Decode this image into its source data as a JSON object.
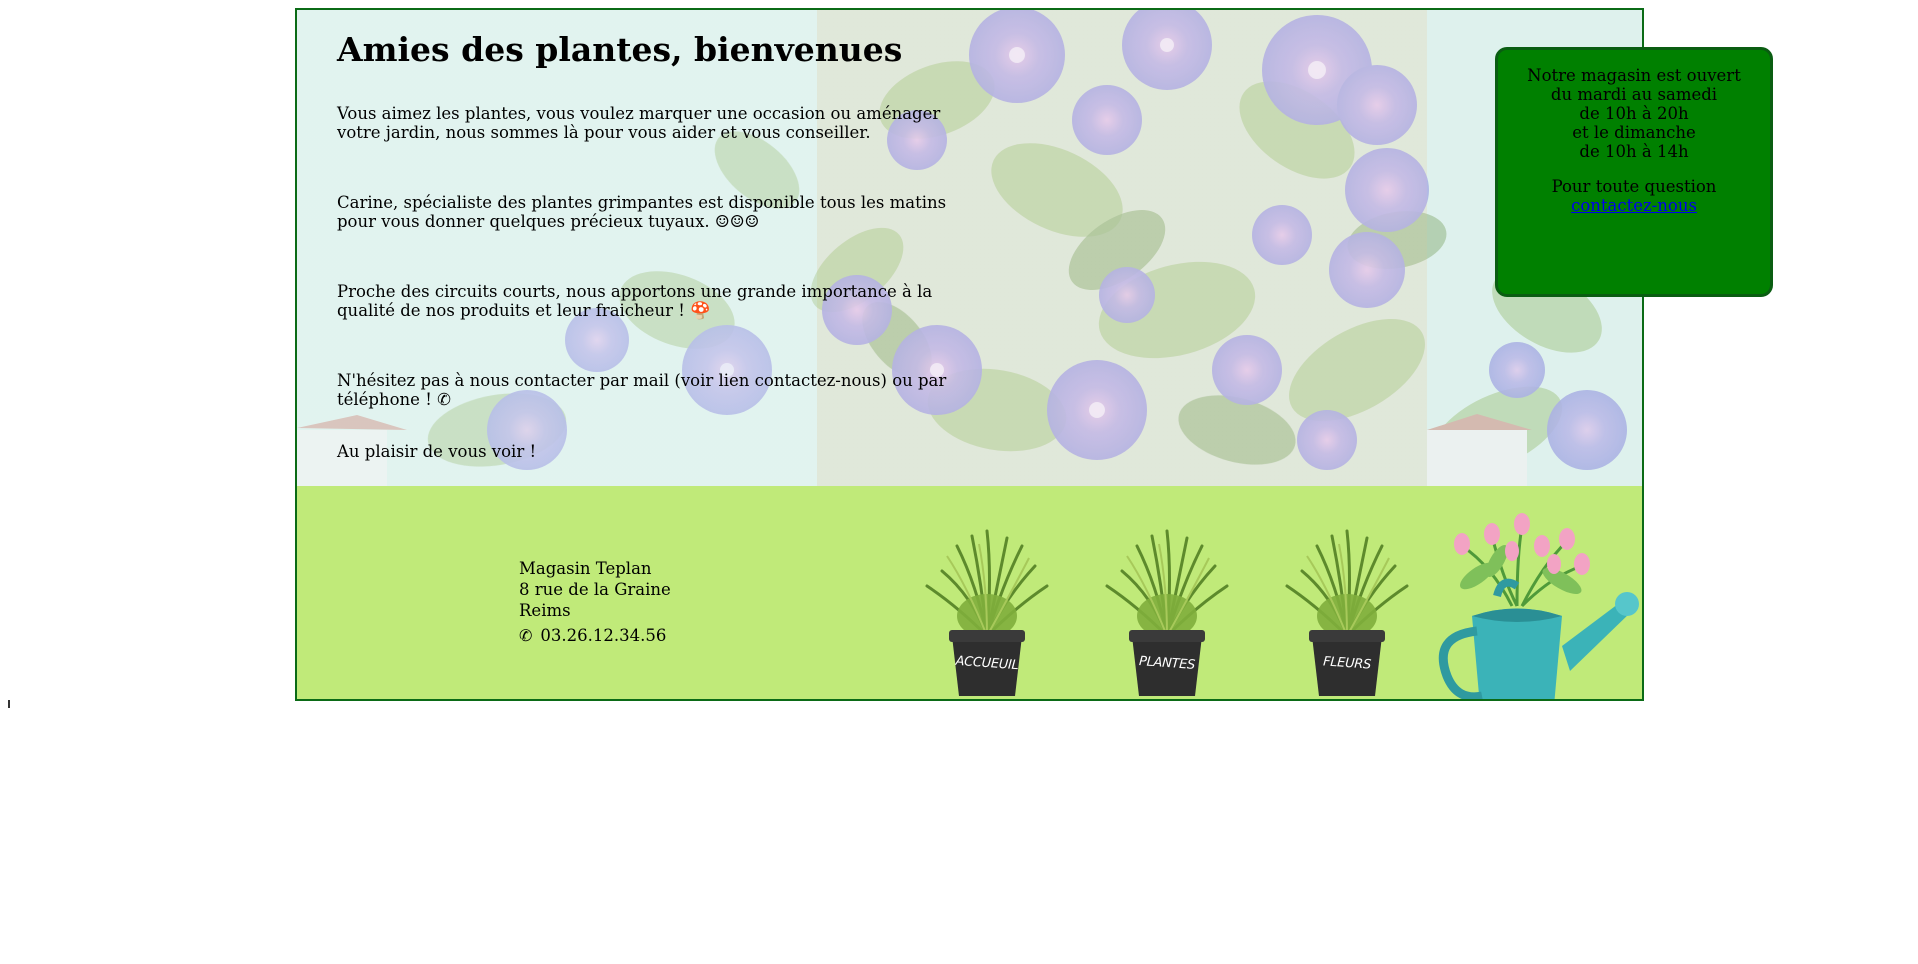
{
  "hero": {
    "title": "Amies des plantes, bienvenues",
    "paragraphs": [
      "Vous aimez les plantes, vous voulez marquer une occasion ou aménager votre jardin, nous sommes là pour vous aider et vous conseiller.",
      "Carine, spécialiste des plantes grimpantes est disponible tous les matins pour vous donner quelques précieux tuyaux. ☺☺☺",
      "Proche des circuits courts, nous apportons une grande importance à la qualité de nos produits et leur fraicheur ! 🍄",
      "N'hésitez pas à nous contacter par mail (voir lien contactez-nous) ou par téléphone ! ✆",
      "Au plaisir de vous voir !"
    ],
    "background_image": "morning-glory-flowers"
  },
  "hours": {
    "lines": [
      "Notre magasin est ouvert",
      "du mardi au samedi",
      "de 10h à 20h",
      "et le dimanche",
      "de 10h à 14h"
    ],
    "contact_prefix": "Pour toute question ",
    "contact_link": "contactez-nous"
  },
  "footer": {
    "address": {
      "name": "Magasin Teplan",
      "street": "8 rue de la Graine",
      "city": "Reims",
      "phone_icon": "phone-icon",
      "phone": "03.26.12.34.56"
    },
    "nav": [
      {
        "label": "ACCUEUIL",
        "icon": "plant-pot-icon"
      },
      {
        "label": "PLANTES",
        "icon": "plant-pot-icon"
      },
      {
        "label": "FLEURS",
        "icon": "plant-pot-icon"
      }
    ],
    "decoration": "watering-can-tulips"
  },
  "colors": {
    "frame_border": "#0b6b16",
    "footer_bg": "#c0ea79",
    "hours_bg": "#008000",
    "link": "#0000ee"
  }
}
